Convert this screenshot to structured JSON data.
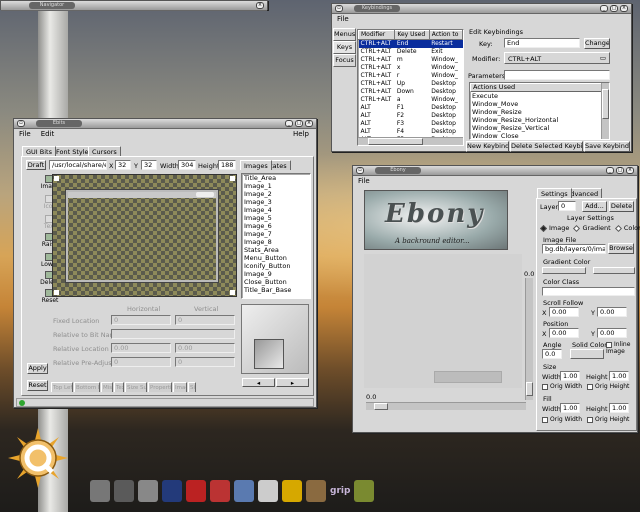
{
  "top_window": {
    "title": "Navigator"
  },
  "keybind": {
    "title": "Keybindings",
    "menu": {
      "file": "File"
    },
    "side_tabs": [
      "Menus",
      "Keys",
      "Focus"
    ],
    "columns": [
      "Modifier",
      "Key Used",
      "Action to"
    ],
    "rows": [
      [
        "CTRL+ALT",
        "End",
        "Restart"
      ],
      [
        "CTRL+ALT",
        "Delete",
        "Exit"
      ],
      [
        "CTRL+ALT",
        "m",
        "Window_"
      ],
      [
        "CTRL+ALT",
        "x",
        "Window_"
      ],
      [
        "CTRL+ALT",
        "r",
        "Window_"
      ],
      [
        "CTRL+ALT",
        "Up",
        "Desktop"
      ],
      [
        "CTRL+ALT",
        "Down",
        "Desktop"
      ],
      [
        "CTRL+ALT",
        "a",
        "Window_"
      ],
      [
        "ALT",
        "F1",
        "Desktop"
      ],
      [
        "ALT",
        "F2",
        "Desktop"
      ],
      [
        "ALT",
        "F3",
        "Desktop"
      ],
      [
        "ALT",
        "F4",
        "Desktop"
      ],
      [
        "ALT",
        "F5",
        "Desktop"
      ]
    ],
    "edit_title": "Edit Keybindings",
    "key_label": "Key:",
    "key_value": "End",
    "change": "Change",
    "modifier_label": "Modifier:",
    "modifier_value": "CTRL+ALT",
    "params_label": "Parameters:",
    "params_value": "",
    "actions_header": "Actions Used",
    "actions": [
      "Execute",
      "Window_Move",
      "Window_Resize",
      "Window_Resize_Horizontal",
      "Window_Resize_Vertical",
      "Window_Close"
    ],
    "new_btn": "New Keybind",
    "delete_btn": "Delete Selected Keybind",
    "save_btn": "Save Keybinds"
  },
  "ebits": {
    "title": "Ebits",
    "menu": {
      "file": "File",
      "edit": "Edit",
      "help": "Help"
    },
    "tabs": [
      "GUI Bits",
      "Font Styles",
      "Cursors"
    ],
    "draft": "Draft",
    "path": "/usr/local/share/enl",
    "x_label": "X",
    "x_val": "32",
    "y_label": "Y",
    "y_val": "32",
    "width_label": "Width",
    "width_val": "304",
    "height_label": "Height",
    "height_val": "188",
    "tab_images": "Images",
    "tab_states": "States",
    "tools": [
      "Image",
      "Icon",
      "Text",
      "Raise",
      "Lower",
      "Delete",
      "Reset"
    ],
    "bits": [
      "Title_Area",
      "Image_1",
      "Image_2",
      "Image_3",
      "Image_4",
      "Image_5",
      "Image_6",
      "Image_7",
      "Image_8",
      "Stats_Area",
      "Menu_Button",
      "Iconify_Button",
      "Image_9",
      "Close_Button",
      "Title_Bar_Base"
    ],
    "horizontal": "Horizontal",
    "vertical": "Vertical",
    "fixed_location": "Fixed Location",
    "fl_h": "0",
    "fl_v": "0",
    "relative_to": "Relative to Bit Name",
    "relative_location": "Relative Location",
    "rl_h": "0.00",
    "rl_v": "0.00",
    "relative_pre": "Relative Pre-Adjust",
    "rp_h": "0",
    "rp_v": "0",
    "apply": "Apply",
    "reset": "Reset",
    "bottom_tabs": [
      "Top Left",
      "Bottom Right",
      "Misc",
      "Text",
      "Size Sum",
      "Properties",
      "Image",
      "Si"
    ],
    "status": ""
  },
  "ebony": {
    "title": "Ebony",
    "menu": {
      "file": "File"
    },
    "banner_title": "Ebony",
    "banner_sub": "A backround editor...",
    "zero_label": "0.0",
    "tabs": [
      "Settings",
      "Advanced"
    ],
    "layer_label": "Layer",
    "layer_val": "0",
    "add": "Add...",
    "delete": "Delete",
    "layer_settings": "Layer Settings",
    "modes": [
      "Image",
      "Gradient",
      "Color"
    ],
    "image_file_label": "Image File",
    "image_file_val": "bg.db/layers/0/image",
    "browse": "Browse",
    "gradient_color": "Gradient Color",
    "color_class": "Color Class",
    "scroll_follow": "Scroll Follow",
    "sf_x": "0.00",
    "sf_y": "0.00",
    "position": "Position",
    "pos_x": "0.00",
    "pos_y": "0.00",
    "angle": "Angle",
    "angle_val": "0.0",
    "solid_color": "Solid Color",
    "inline_image": "Inline Image",
    "size": "Size",
    "size_w": "1.00",
    "size_h": "1.00",
    "orig_width": "Orig Width",
    "orig_height": "Orig Height",
    "fill": "Fill",
    "fill_w": "1.00",
    "fill_h": "1.00",
    "width_label": "Width",
    "height_label": "Height",
    "x_label": "X",
    "y_label": "Y"
  },
  "dock": {
    "items": [
      "terminal-icon",
      "monitor-icon",
      "camera-icon",
      "netscape-icon",
      "star-icon",
      "dragon-icon",
      "fish-icon",
      "chat-icon",
      "penguin-icon",
      "package-icon",
      "grip-icon",
      "gimp-icon"
    ],
    "grip_text": "grip"
  }
}
